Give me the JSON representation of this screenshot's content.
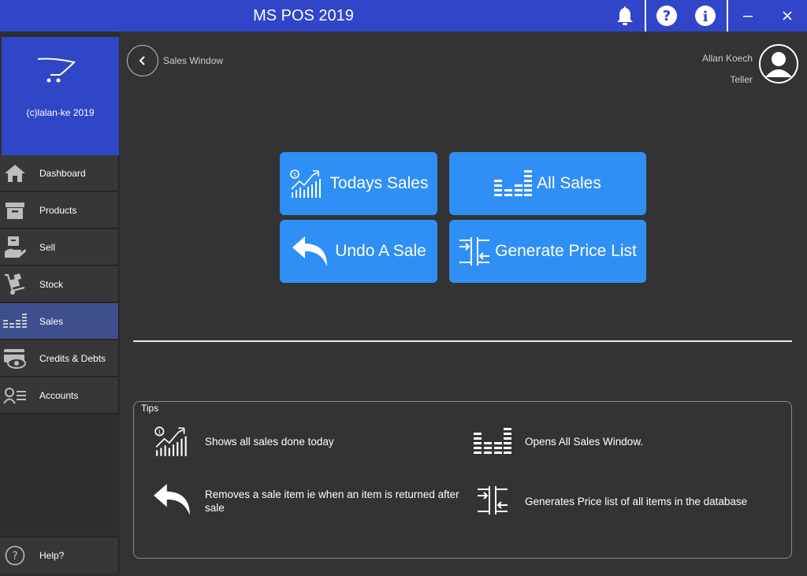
{
  "window": {
    "title": "MS POS 2019"
  },
  "titlebar_icons": [
    "bell-icon",
    "help-circle-icon",
    "info-icon",
    "minimize-icon",
    "close-icon"
  ],
  "brand": {
    "text": "(c)lalan-ke 2019",
    "accent": "#2f46c6"
  },
  "sidebar": {
    "items": [
      {
        "label": "Dashboard",
        "icon": "home-icon"
      },
      {
        "label": "Products",
        "icon": "box-icon"
      },
      {
        "label": "Sell",
        "icon": "sell-hand-icon"
      },
      {
        "label": "Stock",
        "icon": "hand-truck-icon"
      },
      {
        "label": "Sales",
        "icon": "bars-icon",
        "active": true
      },
      {
        "label": "Credits & Debts",
        "icon": "card-eye-icon"
      },
      {
        "label": "Accounts",
        "icon": "accounts-icon"
      }
    ],
    "help": {
      "label": "Help?",
      "icon": "question-icon"
    }
  },
  "header": {
    "breadcrumb": "Sales Window",
    "user_name": "Allan Koech",
    "user_role": "Teller"
  },
  "actions": {
    "todays_sales": "Todays Sales",
    "all_sales": "All Sales",
    "undo_sale": "Undo A Sale",
    "price_list": "Generate Price List"
  },
  "tips": {
    "legend": "Tips",
    "items": [
      {
        "text": "Shows all sales done today"
      },
      {
        "text": "Opens All Sales Window."
      },
      {
        "text": "Removes a sale item ie when an item is returned after sale"
      },
      {
        "text": "Generates Price list of all items in the database"
      }
    ]
  },
  "colors": {
    "titlebar": "#3045c8",
    "button": "#2f8ff5",
    "background": "#333333"
  }
}
